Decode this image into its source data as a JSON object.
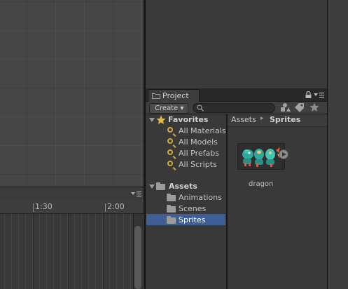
{
  "animation": {
    "ruler": {
      "tick_1": "1:30",
      "tick_2": "2:00"
    },
    "menu_icon": "panel-menu-icon"
  },
  "project": {
    "tab_label": "Project",
    "create_label": "Create ▾",
    "search": {
      "placeholder": "",
      "icon": "search-icon"
    },
    "toolbar_icons": [
      "filter-type-icon",
      "filter-label-icon",
      "favorite-star-icon"
    ],
    "tree": {
      "favorites_label": "Favorites",
      "favorites": [
        "All Materials",
        "All Models",
        "All Prefabs",
        "All Scripts"
      ],
      "assets_label": "Assets",
      "folders": [
        "Animations",
        "Scenes",
        "Sprites"
      ],
      "selected": "Sprites"
    },
    "breadcrumb": {
      "root": "Assets",
      "separator": "▸",
      "current": "Sprites"
    },
    "assets": [
      {
        "name": "dragon"
      }
    ]
  },
  "colors": {
    "selection": "#3e5f96",
    "favorite_icon": "#d7a93a"
  }
}
